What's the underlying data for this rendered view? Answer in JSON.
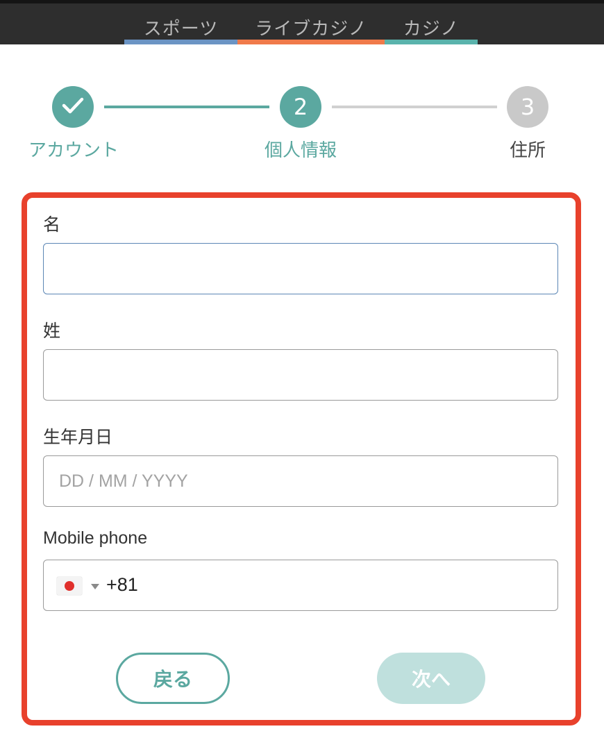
{
  "category_tabs": [
    {
      "label": "スポーツ",
      "underline_color": "#6b94c4"
    },
    {
      "label": "ライブカジノ",
      "underline_color": "#f07a4a"
    },
    {
      "label": "カジノ",
      "underline_color": "#5ab3ac"
    }
  ],
  "stepper": {
    "steps": [
      {
        "number": "✓",
        "label": "アカウント",
        "state": "completed",
        "color": "#5ba8a0"
      },
      {
        "number": "2",
        "label": "個人情報",
        "state": "active",
        "color": "#5ba8a0"
      },
      {
        "number": "3",
        "label": "住所",
        "state": "inactive",
        "color": "#c9c9c9"
      }
    ]
  },
  "form": {
    "first_name": {
      "label": "名",
      "value": "",
      "placeholder": ""
    },
    "last_name": {
      "label": "姓",
      "value": "",
      "placeholder": ""
    },
    "birthdate": {
      "label": "生年月日",
      "value": "",
      "placeholder": "DD / MM / YYYY"
    },
    "mobile": {
      "label": "Mobile phone",
      "country_flag": "japan-flag-icon",
      "country_code": "+81"
    }
  },
  "buttons": {
    "back_label": "戻る",
    "next_label": "次へ",
    "next_state": "disabled"
  },
  "colors": {
    "accent": "#5ba8a0",
    "highlight_border": "#e8412c",
    "topbar": "#2e2e2e"
  }
}
